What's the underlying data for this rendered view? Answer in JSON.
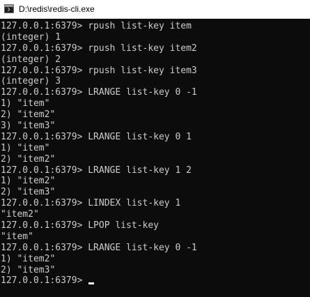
{
  "window": {
    "title": "D:\\redis\\redis-cli.exe"
  },
  "icons": {
    "app": "console-app-icon"
  },
  "colors": {
    "background": "#0c0c0c",
    "foreground": "#cccccc",
    "cursor": "#ffffff",
    "titlebar": "#ffffff"
  },
  "console": {
    "lines": [
      "127.0.0.1:6379> rpush list-key item",
      "(integer) 1",
      "127.0.0.1:6379> rpush list-key item2",
      "(integer) 2",
      "127.0.0.1:6379> rpush list-key item3",
      "(integer) 3",
      "127.0.0.1:6379> LRANGE list-key 0 -1",
      "1) \"item\"",
      "2) \"item2\"",
      "3) \"item3\"",
      "127.0.0.1:6379> LRANGE list-key 0 1",
      "1) \"item\"",
      "2) \"item2\"",
      "127.0.0.1:6379> LRANGE list-key 1 2",
      "1) \"item2\"",
      "2) \"item3\"",
      "127.0.0.1:6379> LINDEX list-key 1",
      "\"item2\"",
      "127.0.0.1:6379> LPOP list-key",
      "\"item\"",
      "127.0.0.1:6379> LRANGE list-key 0 -1",
      "1) \"item2\"",
      "2) \"item3\""
    ],
    "prompt": "127.0.0.1:6379> "
  }
}
